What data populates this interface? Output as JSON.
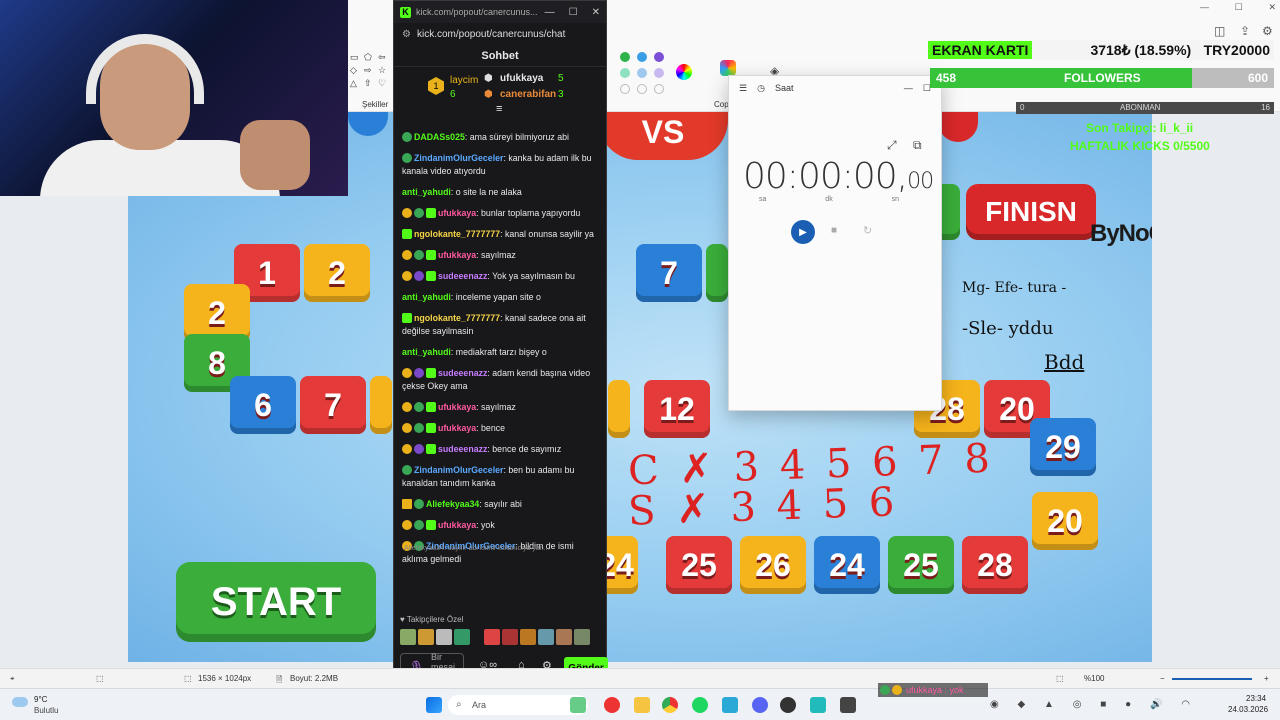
{
  "paint": {
    "shapes_label": "Şekiller",
    "copilot_label": "Cop",
    "canvas_size": "1536 × 1024px",
    "file_size": "Boyut: 2.2MB",
    "zoom": "%100"
  },
  "board": {
    "start_label": "START",
    "finish_label": "FINISN",
    "watermark": "ByNoGame",
    "tiles_row1": [
      "1",
      "2",
      "7",
      "20",
      "12",
      "28",
      "20"
    ],
    "tiles_left": [
      "2",
      "8",
      "6",
      "7"
    ],
    "tiles_row3": [
      "29",
      "20"
    ],
    "tiles_bottom": [
      "24",
      "25",
      "26",
      "24",
      "25",
      "28"
    ],
    "vs": "VS",
    "handwriting_1": "C ✗ 3 4 5 6 7 8",
    "handwriting_2": "S ✗ 3 4 5 6",
    "scribble_1": "Mg- Efe- tura -",
    "scribble_2": "-Sle- yddu",
    "scribble_3": "Bdd"
  },
  "chat": {
    "url_short": "kick.com/popout/canercunus...",
    "url": "kick.com/popout/canercunus/chat",
    "header": "Sohbet",
    "leaders": [
      {
        "name": "laycim",
        "count": "6"
      },
      {
        "name": "ufukkaya",
        "count": "5"
      },
      {
        "name": "canerabifan",
        "count": "3"
      }
    ],
    "messages": [
      {
        "user": "DADASs025",
        "color": "#53fc18",
        "badges": [
          "green"
        ],
        "text": "ama süreyi bilmiyoruz abi"
      },
      {
        "user": "ZindanimOlurGeceler",
        "color": "#5aa9ff",
        "badges": [
          "green"
        ],
        "text": "kanka bu adam ilk bu kanala video atıyordu"
      },
      {
        "user": "anti_yahudi",
        "color": "#53fc18",
        "badges": [],
        "text": "o site la ne alaka"
      },
      {
        "user": "ufukkaya",
        "color": "#ff5aa0",
        "badges": [
          "gold",
          "green",
          "sub"
        ],
        "text": "bunlar toplama yapıyordu"
      },
      {
        "user": "ngolokante_7777777",
        "color": "#f5d547",
        "badges": [
          "sub"
        ],
        "text": "kanal onunsa sayilir ya"
      },
      {
        "user": "ufukkaya",
        "color": "#ff5aa0",
        "badges": [
          "gold",
          "green",
          "sub"
        ],
        "text": "sayılmaz"
      },
      {
        "user": "sudeeenazz",
        "color": "#c77dff",
        "badges": [
          "gold",
          "purple",
          "sub"
        ],
        "text": "Yok ya sayılmasın bu"
      },
      {
        "user": "anti_yahudi",
        "color": "#53fc18",
        "badges": [],
        "text": "inceleme yapan site o"
      },
      {
        "user": "ngolokante_7777777",
        "color": "#f5d547",
        "badges": [
          "sub"
        ],
        "text": "kanal sadece ona ait değilse sayilmasin"
      },
      {
        "user": "anti_yahudi",
        "color": "#53fc18",
        "badges": [],
        "text": "mediakraft tarzı bişey o"
      },
      {
        "user": "sudeeenazz",
        "color": "#c77dff",
        "badges": [
          "gold",
          "purple",
          "sub"
        ],
        "text": "adam kendi başına video çekse Okey ama"
      },
      {
        "user": "ufukkaya",
        "color": "#ff5aa0",
        "badges": [
          "gold",
          "green",
          "sub"
        ],
        "text": "sayılmaz"
      },
      {
        "user": "ufukkaya",
        "color": "#ff5aa0",
        "badges": [
          "gold",
          "green",
          "sub"
        ],
        "text": "bence"
      },
      {
        "user": "sudeeenazz",
        "color": "#c77dff",
        "badges": [
          "gold",
          "purple",
          "sub"
        ],
        "text": "bence de sayımız"
      },
      {
        "user": "ZindanimOlurGeceler",
        "color": "#5aa9ff",
        "badges": [
          "green"
        ],
        "text": "ben bu adamı bu kanaldan tanıdım kanka"
      },
      {
        "user": "Aliefekyaa34",
        "color": "#53fc18",
        "badges": [
          "crown",
          "green"
        ],
        "text": "sayılır abi"
      },
      {
        "user": "ufukkaya",
        "color": "#ff5aa0",
        "badges": [
          "gold",
          "green",
          "sub"
        ],
        "text": "yok"
      },
      {
        "user": "ZindanimOlurGeceler",
        "color": "#5aa9ff",
        "badges": [
          "gold",
          "green"
        ],
        "text": "bildim de ismi aklıma gelmedi"
      }
    ],
    "reply_preview": "Aliefekyaa34: sayılır abi isimil kullanıcıya yan...",
    "followers_special": "Takipçilere Özel",
    "input_placeholder": "Bir mesaj gönderin",
    "send": "Gönder"
  },
  "clock": {
    "title": "Saat",
    "time_main": "00:00:00,",
    "time_ms": "00",
    "units": [
      "sa",
      "dk",
      "sn"
    ]
  },
  "overlay": {
    "ekran_karti": "EKRAN KARTI",
    "price": "3718₺ (18.59%)",
    "goal": "TRY20000",
    "followers_current": "458",
    "followers_label": "FOLLOWERS",
    "followers_goal": "600",
    "followers_fraction": 0.763,
    "abonman_start": "0",
    "abonman_label": "ABONMAN",
    "abonman_goal": "16",
    "last_follower": "Son Takipçi: li_k_ii",
    "weekly": "HAFTALIK KICKS 0/5500",
    "chat_overlay": "ufukkaya : yok"
  },
  "taskbar": {
    "weather_temp": "9°C",
    "weather_desc": "Bulutlu",
    "search": "Ara",
    "time": "23:34",
    "date": "24.03.2026"
  }
}
